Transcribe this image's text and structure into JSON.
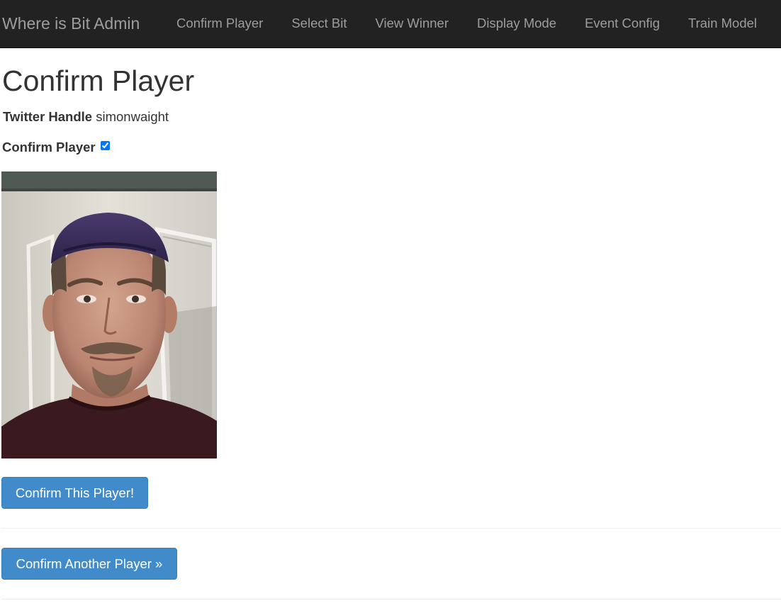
{
  "navbar": {
    "brand": "Where is Bit Admin",
    "links": [
      {
        "label": "Confirm Player"
      },
      {
        "label": "Select Bit"
      },
      {
        "label": "View Winner"
      },
      {
        "label": "Display Mode"
      },
      {
        "label": "Event Config"
      },
      {
        "label": "Train Model"
      }
    ]
  },
  "page": {
    "title": "Confirm Player",
    "twitter_handle_label": "Twitter Handle",
    "twitter_handle_value": "simonwaight",
    "confirm_label": "Confirm Player",
    "confirm_checked": true,
    "photo_description": "player-photo",
    "confirm_button": "Confirm This Player!",
    "another_button": "Confirm Another Player »"
  },
  "colors": {
    "navbar_bg": "#222222",
    "nav_text": "#9d9d9d",
    "button_primary": "#428bca",
    "text": "#333333"
  }
}
